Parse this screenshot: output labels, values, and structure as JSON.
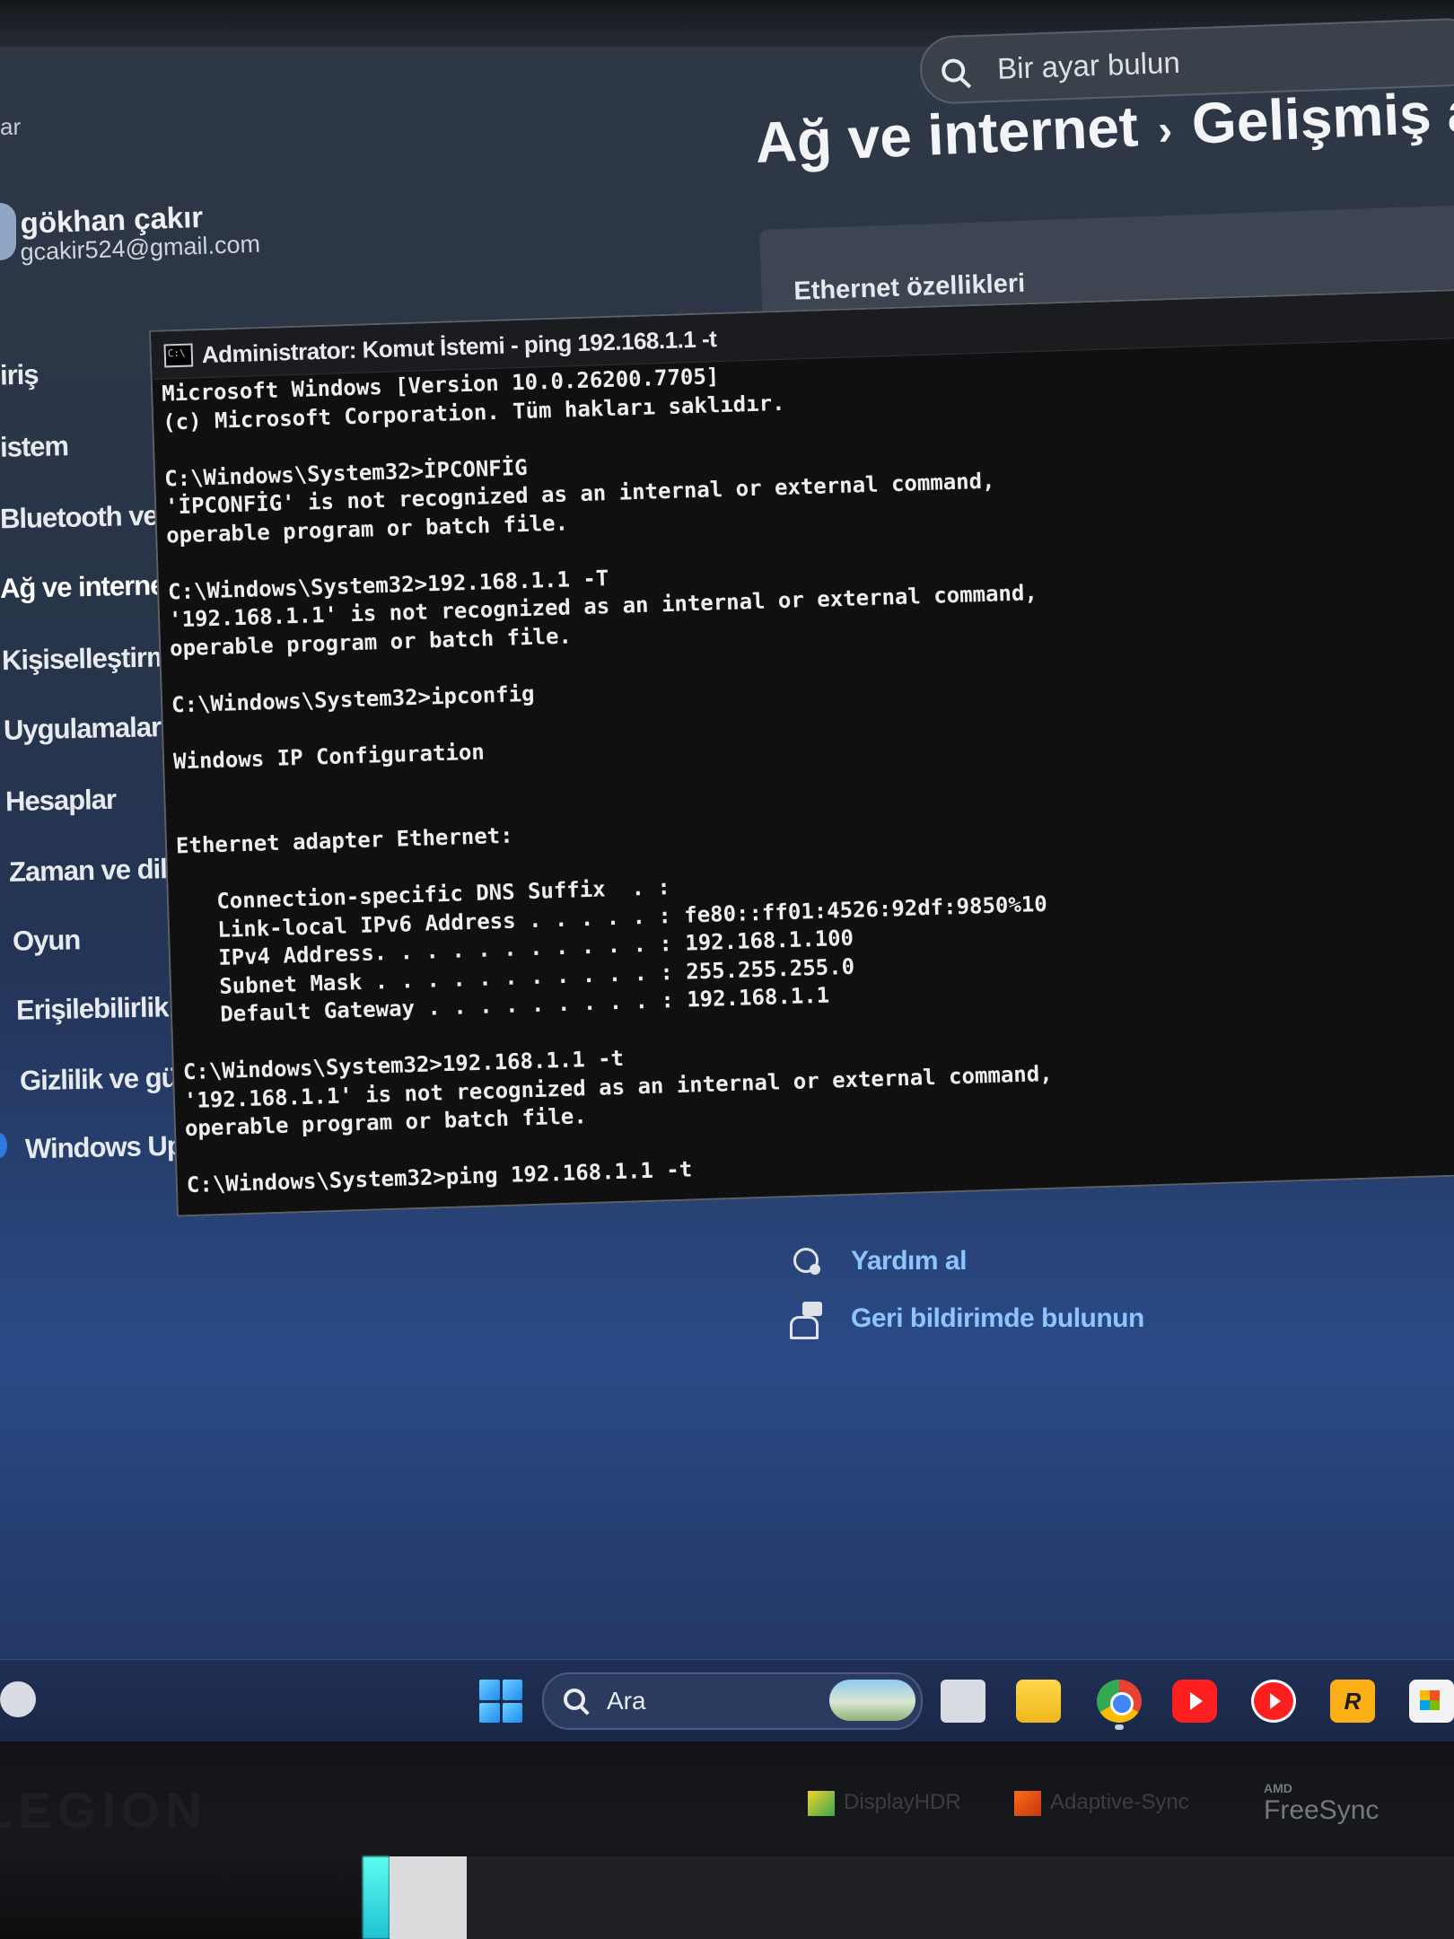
{
  "settings": {
    "search_placeholder": "Bir ayar bulun",
    "breadcrumb": {
      "parent": "Ağ ve internet",
      "separator": "›",
      "current": "Gelişmiş ağ a"
    },
    "corner_text": "ar",
    "user": {
      "name": "gökhan çakır",
      "email": "gcakir524@gmail.com"
    },
    "nav": [
      {
        "label": "iriş"
      },
      {
        "label": "istem"
      },
      {
        "label": "Bluetooth ve cih"
      },
      {
        "label": "Ağ ve internet"
      },
      {
        "label": "Kişiselleştirme"
      },
      {
        "label": "Uygulamalar"
      },
      {
        "label": "Hesaplar"
      },
      {
        "label": "Zaman ve dil"
      },
      {
        "label": "Oyun"
      },
      {
        "label": "Erişilebilirlik"
      },
      {
        "label": "Gizlilik ve güven"
      },
      {
        "label": "Windows Updat"
      }
    ],
    "card_title": "Ethernet özellikleri",
    "help": {
      "get_help": "Yardım al",
      "feedback": "Geri bildirimde bulunun"
    }
  },
  "cmd": {
    "title": "Administrator: Komut İstemi - ping  192.168.1.1 -t",
    "output": [
      "Microsoft Windows [Version 10.0.26200.7705]",
      "(c) Microsoft Corporation. Tüm hakları saklıdır.",
      "",
      "C:\\Windows\\System32>İPCONFİG",
      "'İPCONFİG' is not recognized as an internal or external command,",
      "operable program or batch file.",
      "",
      "C:\\Windows\\System32>192.168.1.1 -T",
      "'192.168.1.1' is not recognized as an internal or external command,",
      "operable program or batch file.",
      "",
      "C:\\Windows\\System32>ipconfig",
      "",
      "Windows IP Configuration",
      "",
      "",
      "Ethernet adapter Ethernet:",
      "",
      "   Connection-specific DNS Suffix  . :",
      "   Link-local IPv6 Address . . . . . : fe80::ff01:4526:92df:9850%10",
      "   IPv4 Address. . . . . . . . . . . : 192.168.1.100",
      "   Subnet Mask . . . . . . . . . . . : 255.255.255.0",
      "   Default Gateway . . . . . . . . . : 192.168.1.1",
      "",
      "C:\\Windows\\System32>192.168.1.1 -t",
      "'192.168.1.1' is not recognized as an internal or external command,",
      "operable program or batch file.",
      "",
      "C:\\Windows\\System32>ping 192.168.1.1 -t"
    ]
  },
  "taskbar": {
    "search_label": "Ara",
    "apps": [
      "start-icon",
      "task-view-icon",
      "file-explorer-icon",
      "chrome-icon",
      "youtube-icon",
      "youtube-music-icon",
      "rockstar-icon",
      "store-icon"
    ],
    "rockstar_letter": "R"
  },
  "monitor": {
    "brand": "LEGION",
    "badge_hdr": "DisplayHDR",
    "badge_adaptive": "Adaptive-Sync",
    "amd": "AMD",
    "freesync": "FreeSync"
  }
}
